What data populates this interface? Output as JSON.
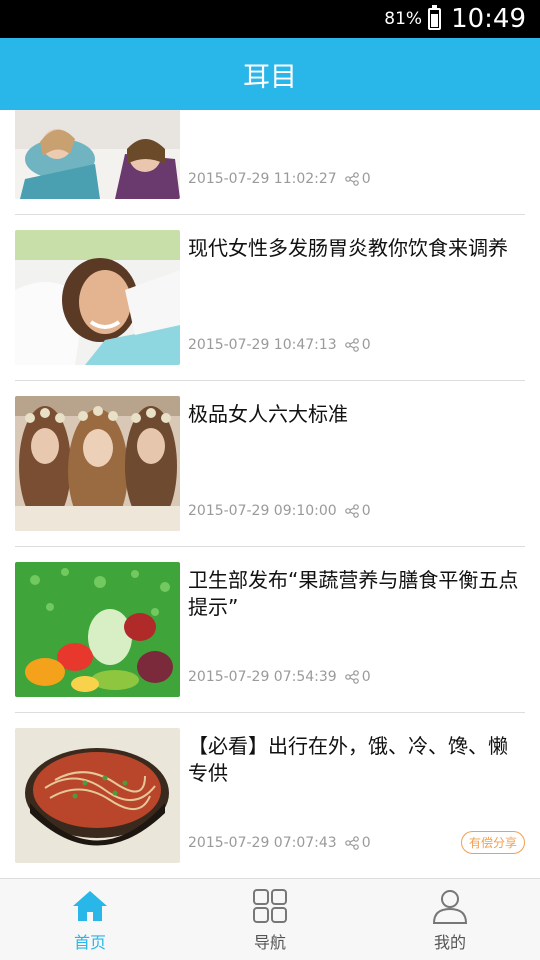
{
  "status": {
    "battery": "81%",
    "time": "10:49"
  },
  "header": {
    "title": "耳目"
  },
  "feed": [
    {
      "title": "",
      "date": "2015-07-29 11:02:27",
      "shares": "0",
      "thumb": "women-icon"
    },
    {
      "title": "现代女性多发肠胃炎教你饮食来调养",
      "date": "2015-07-29 10:47:13",
      "shares": "0",
      "thumb": "woman-icon"
    },
    {
      "title": "极品女人六大标准",
      "date": "2015-07-29 09:10:00",
      "shares": "0",
      "thumb": "three-women-icon"
    },
    {
      "title": "卫生部发布“果蔬营养与膳食平衡五点提示”",
      "date": "2015-07-29 07:54:39",
      "shares": "0",
      "thumb": "vegetables-icon"
    },
    {
      "title": "【必看】出行在外，饿、冷、馋、懒专供",
      "date": "2015-07-29 07:07:43",
      "shares": "0",
      "thumb": "noodle-bowl-icon",
      "badge": "有偿分享"
    }
  ],
  "tabs": [
    {
      "label": "首页",
      "icon": "home-icon",
      "active": true
    },
    {
      "label": "导航",
      "icon": "grid-icon",
      "active": false
    },
    {
      "label": "我的",
      "icon": "user-icon",
      "active": false
    }
  ],
  "colors": {
    "accent": "#29b6e8",
    "badge": "#f0a050"
  }
}
